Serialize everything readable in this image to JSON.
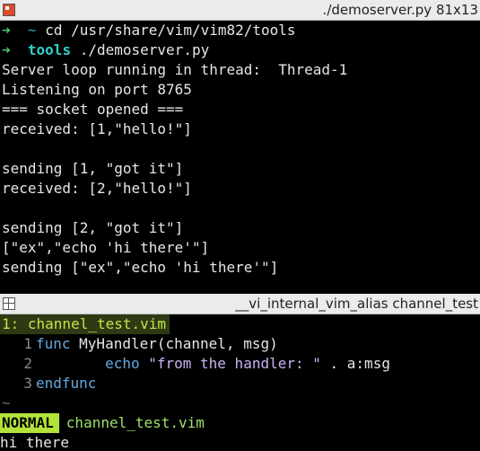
{
  "top_window": {
    "title": "./demoserver.py 81x13"
  },
  "shell": {
    "cmd1_prompt": "~",
    "cmd1_text": "cd /usr/share/vim/vim82/tools",
    "cmd2_prompt": "tools",
    "cmd2_text": "./demoserver.py",
    "output": [
      "Server loop running in thread:  Thread-1",
      "Listening on port 8765",
      "=== socket opened ===",
      "received: [1,\"hello!\"]",
      "",
      "sending [1, \"got it\"]",
      "received: [2,\"hello!\"]",
      "",
      "sending [2, \"got it\"]",
      "[\"ex\",\"echo 'hi there'\"]",
      "sending [\"ex\",\"echo 'hi there'\"]"
    ]
  },
  "bottom_window": {
    "title": "__vi_internal_vim_alias channel_test"
  },
  "vim": {
    "tab_label": "1: channel_test.vim",
    "code": [
      {
        "num": "1",
        "kw": "func",
        "text": " MyHandler(channel, msg)"
      },
      {
        "num": "2",
        "indent": "        ",
        "kw": "echo",
        "str": " \"from the handler: \"",
        "text": " . a:msg"
      },
      {
        "num": "3",
        "kw": "endfunc",
        "text": ""
      }
    ],
    "eob_marker": "~",
    "mode": "NORMAL",
    "filename": "channel_test.vim",
    "message": "hi there"
  }
}
